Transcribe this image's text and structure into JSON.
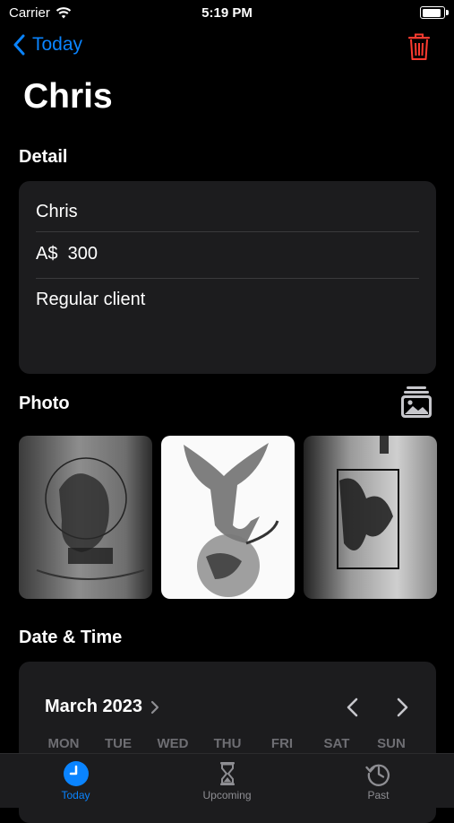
{
  "status": {
    "carrier": "Carrier",
    "time": "5:19 PM"
  },
  "nav": {
    "back_label": "Today"
  },
  "title": "Chris",
  "detail": {
    "section_label": "Detail",
    "name": "Chris",
    "currency": "A$",
    "amount": "300",
    "notes": "Regular client"
  },
  "photo": {
    "section_label": "Photo"
  },
  "datetime": {
    "section_label": "Date & Time",
    "month": "March 2023",
    "weekdays": [
      "MON",
      "TUE",
      "WED",
      "THU",
      "FRI",
      "SAT",
      "SUN"
    ]
  },
  "tabs": [
    {
      "label": "Today",
      "icon": "clock-icon",
      "active": true
    },
    {
      "label": "Upcoming",
      "icon": "hourglass-icon",
      "active": false
    },
    {
      "label": "Past",
      "icon": "history-icon",
      "active": false
    }
  ],
  "colors": {
    "accent": "#0a84ff",
    "destructive": "#ff3b30",
    "card": "#1c1c1e"
  }
}
